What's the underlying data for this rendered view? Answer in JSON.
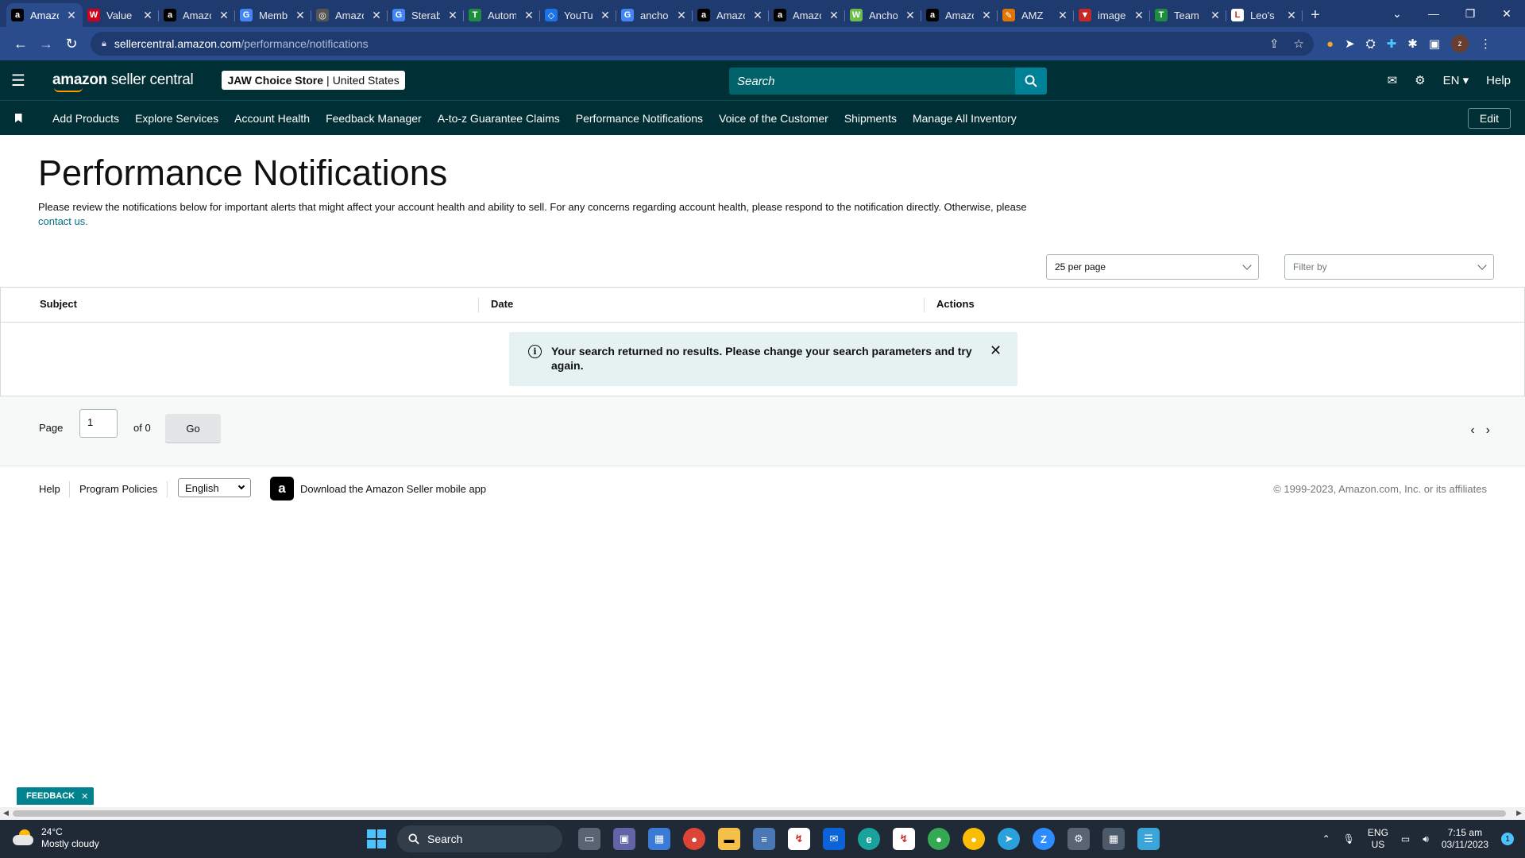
{
  "browser": {
    "tabs": [
      {
        "label": "Amazon",
        "fav": "a",
        "fav_color": "#000000",
        "active": true
      },
      {
        "label": "Value",
        "fav": "W",
        "fav_color": "#d0021b"
      },
      {
        "label": "Amazon",
        "fav": "a",
        "fav_color": "#000000"
      },
      {
        "label": "Members",
        "fav": "G",
        "fav_color": "#4285f4"
      },
      {
        "label": "Amazon",
        "fav": "◎",
        "fav_color": "#555555"
      },
      {
        "label": "Sterab",
        "fav": "G",
        "fav_color": "#4285f4"
      },
      {
        "label": "Autom",
        "fav": "T",
        "fav_color": "#1e8e3e"
      },
      {
        "label": "YouTube",
        "fav": "◇",
        "fav_color": "#1a73e8"
      },
      {
        "label": "anchor",
        "fav": "G",
        "fav_color": "#4285f4"
      },
      {
        "label": "Amazon",
        "fav": "a",
        "fav_color": "#000000"
      },
      {
        "label": "Amazon",
        "fav": "a",
        "fav_color": "#000000"
      },
      {
        "label": "Anchor",
        "fav": "W",
        "fav_color": "#6abf4b"
      },
      {
        "label": "Amazon",
        "fav": "a",
        "fav_color": "#000000"
      },
      {
        "label": "AMZ",
        "fav": "✎",
        "fav_color": "#e37400"
      },
      {
        "label": "image",
        "fav": "▼",
        "fav_color": "#c62828"
      },
      {
        "label": "Team",
        "fav": "T",
        "fav_color": "#1e8e3e"
      },
      {
        "label": "Leo's",
        "fav": "L",
        "fav_color": "#ffffff"
      }
    ],
    "url_host": "sellercentral.amazon.com",
    "url_path": "/performance/notifications",
    "profile_initial": "z"
  },
  "header": {
    "logo_brand": "amazon",
    "logo_product": " seller central",
    "store_name": "JAW Choice Store",
    "store_region": "United States",
    "search_placeholder": "Search",
    "language": "EN",
    "help": "Help"
  },
  "nav": {
    "items": [
      "Add Products",
      "Explore Services",
      "Account Health",
      "Feedback Manager",
      "A-to-z Guarantee Claims",
      "Performance Notifications",
      "Voice of the Customer",
      "Shipments",
      "Manage All Inventory"
    ],
    "edit_label": "Edit"
  },
  "page": {
    "title": "Performance Notifications",
    "description": "Please review the notifications below for important alerts that might affect your account health and ability to sell. For any concerns regarding account health, please respond to the notification directly. Otherwise, please",
    "contact_link": "contact us.",
    "per_page": "25 per page",
    "filter_placeholder": "Filter by"
  },
  "table": {
    "columns": [
      "Subject",
      "Date",
      "Actions"
    ],
    "empty_message": "Your search returned no results. Please change your search parameters and try again."
  },
  "pager": {
    "page_label": "Page",
    "current_page": "1",
    "of_label": "of 0",
    "go_label": "Go"
  },
  "footer": {
    "help": "Help",
    "program_policies": "Program Policies",
    "language": "English",
    "app_download": "Download the Amazon Seller mobile app",
    "copyright": "© 1999-2023, Amazon.com, Inc. or its affiliates"
  },
  "feedback": {
    "label": "FEEDBACK"
  },
  "taskbar": {
    "temperature": "24°C",
    "weather": "Mostly cloudy",
    "search": "Search",
    "lang_top": "ENG",
    "lang_bottom": "US",
    "time": "7:15 am",
    "date": "03/11/2023",
    "notifications": "1"
  },
  "colors": {
    "header_bg": "#002f36",
    "search_btn": "#008296",
    "link": "#007185",
    "alert_bg": "#e6f2f2",
    "browser_frame": "#1e3a6e"
  }
}
